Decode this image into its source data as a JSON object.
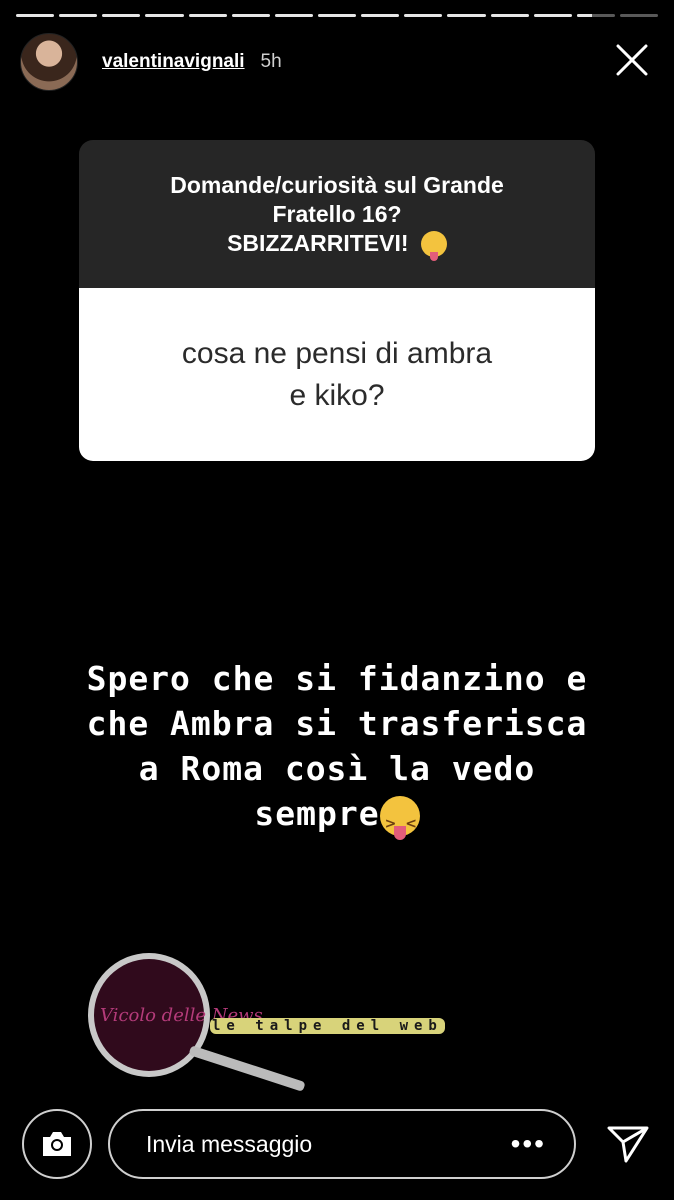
{
  "progress": {
    "segments": 15,
    "current_index": 13
  },
  "header": {
    "username": "valentinavignali",
    "time": "5h"
  },
  "question_card": {
    "prompt_line1": "Domande/curiosità sul Grande",
    "prompt_line2": "Fratello 16?",
    "prompt_line3": "SBIZZARRITEVI!",
    "answer_line1": "cosa ne pensi di ambra",
    "answer_line2": "e kiko?"
  },
  "reply": {
    "line1": "Spero che si fidanzino e",
    "line2": "che Ambra si trasferisca",
    "line3": "a Roma così la vedo",
    "line4": "sempre"
  },
  "watermark": {
    "tagline": "le talpe del web",
    "logo_text": "Vicolo delle News"
  },
  "footer": {
    "message_placeholder": "Invia messaggio",
    "more_label": "•••"
  },
  "colors": {
    "card_dark": "#262626",
    "card_light": "#ffffff",
    "accent_pink": "#b43b7a"
  },
  "icons": [
    "close-icon",
    "camera-icon",
    "more-dots-icon",
    "send-icon"
  ]
}
